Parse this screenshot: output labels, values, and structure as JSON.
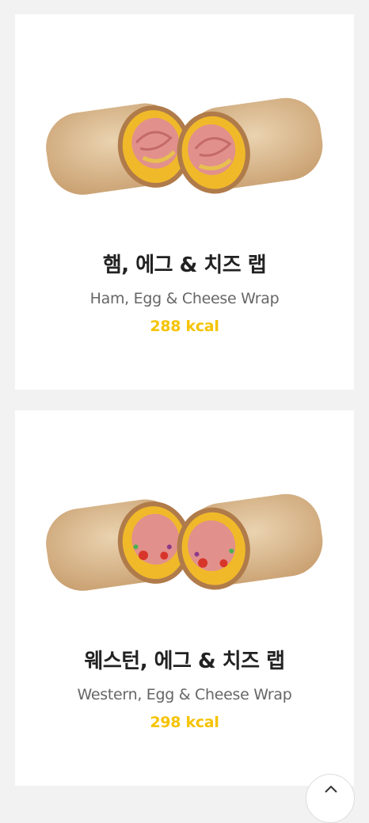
{
  "menu_items": [
    {
      "name_ko": "햄, 에그 & 치즈 랩",
      "name_en": "Ham, Egg & Cheese Wrap",
      "kcal": "288 kcal",
      "image": "ham-egg-cheese-wrap"
    },
    {
      "name_ko": "웨스턴, 에그 & 치즈 랩",
      "name_en": "Western, Egg & Cheese Wrap",
      "kcal": "298 kcal",
      "image": "western-egg-cheese-wrap"
    }
  ],
  "scroll_top": {
    "icon": "chevron-up-icon"
  },
  "colors": {
    "background": "#f2f2f2",
    "card": "#ffffff",
    "title": "#222222",
    "subtitle": "#666666",
    "kcal": "#f5c300"
  }
}
